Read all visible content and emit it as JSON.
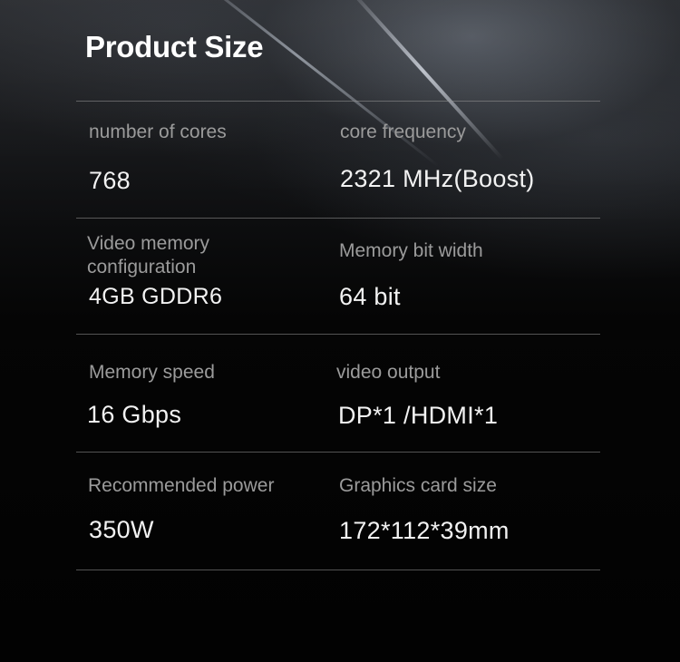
{
  "title": "Product Size",
  "specs": [
    {
      "label": "number of cores",
      "value": "768"
    },
    {
      "label": "core frequency",
      "value": "2321 MHz(Boost)"
    },
    {
      "label_line1": "Video memory",
      "label_line2": "configuration",
      "value": "4GB GDDR6"
    },
    {
      "label": "Memory bit width",
      "value": "64 bit"
    },
    {
      "label": "Memory speed",
      "value": "16 Gbps"
    },
    {
      "label": "video output",
      "value": "DP*1 /HDMI*1"
    },
    {
      "label": "Recommended power",
      "value": "350W"
    },
    {
      "label": "Graphics card size",
      "value": "172*112*39mm"
    }
  ]
}
